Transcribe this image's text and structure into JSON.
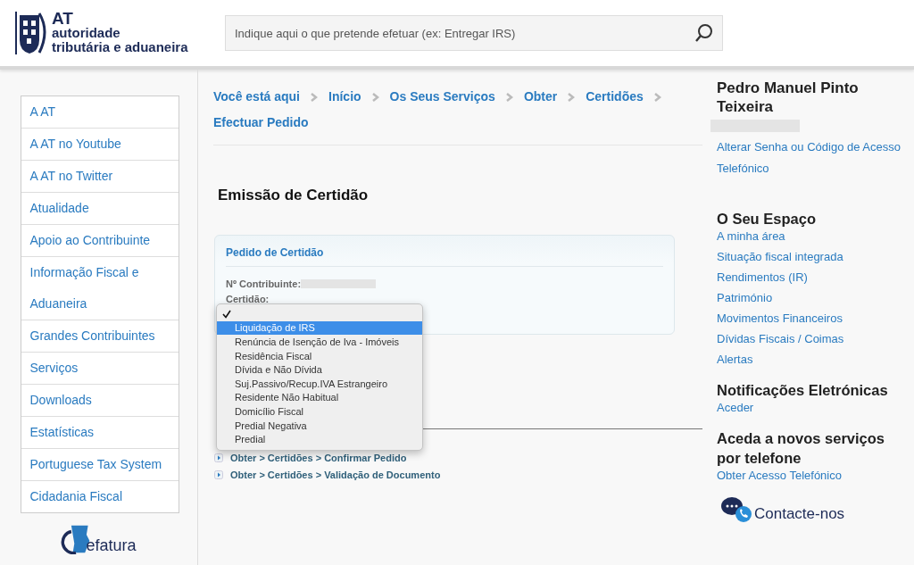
{
  "header": {
    "logo": {
      "abbr": "AT",
      "line_1": "autoridade",
      "line_2": "tributária e aduaneira"
    },
    "search": {
      "placeholder": "Indique aqui o que pretende efetuar (ex: Entregar IRS)"
    }
  },
  "sidebar": {
    "items": [
      {
        "label": "A AT"
      },
      {
        "label": "A AT no Youtube"
      },
      {
        "label": "A AT no Twitter"
      },
      {
        "label": "Atualidade"
      },
      {
        "label": "Apoio ao Contribuinte"
      },
      {
        "label": "Informação Fiscal e Aduaneira"
      },
      {
        "label": "Grandes Contribuintes"
      },
      {
        "label": "Serviços"
      },
      {
        "label": "Downloads"
      },
      {
        "label": "Estatísticas"
      },
      {
        "label": "Portuguese Tax System"
      },
      {
        "label": "Cidadania Fiscal"
      }
    ],
    "logo_text": "efatura"
  },
  "breadcrumb": [
    "Você está aqui",
    "Início",
    "Os Seus Serviços",
    "Obter",
    "Certidões",
    "Efectuar Pedido"
  ],
  "page_title": "Emissão de Certidão",
  "form": {
    "title": "Pedido de Certidão",
    "fields": [
      {
        "label": "Nº Contribuinte:",
        "redacted": true
      },
      {
        "label": "Certidão:",
        "redacted": false
      }
    ],
    "dropdown": {
      "options": [
        {
          "checked": true,
          "selected": false
        },
        {
          "label": "Liquidação de IRS",
          "checked": false,
          "selected": true
        },
        {
          "label": "Renúncia de Isenção de Iva - Imóveis",
          "checked": false,
          "selected": false
        },
        {
          "label": "Residência Fiscal",
          "checked": false,
          "selected": false
        },
        {
          "label": "Dívida e Não Dívida",
          "checked": false,
          "selected": false
        },
        {
          "label": "Suj.Passivo/Recup.IVA Estrangeiro",
          "checked": false,
          "selected": false
        },
        {
          "label": "Residente Não Habitual",
          "checked": false,
          "selected": false
        },
        {
          "label": "Domicílio Fiscal",
          "checked": false,
          "selected": false
        },
        {
          "label": "Predial Negativa",
          "checked": false,
          "selected": false
        },
        {
          "label": "Predial",
          "checked": false,
          "selected": false
        }
      ]
    }
  },
  "links": [
    "Obter > Certidões > Confirmar Pedido",
    "Obter > Certidões > Validação de Documento"
  ],
  "user": {
    "name": "Pedro Manuel Pinto Teixeira",
    "links": [
      "Alterar Senha ou Código de Acesso",
      "Telefónico"
    ]
  },
  "sections": [
    {
      "title": "O Seu Espaço",
      "links": [
        "A minha área",
        "Situação fiscal integrada",
        "Rendimentos (IR)",
        "Património",
        "Movimentos Financeiros",
        "Dívidas Fiscais / Coimas",
        "Alertas"
      ]
    },
    {
      "title": "Notificações Eletrónicas",
      "links": [
        "Aceder"
      ]
    },
    {
      "title": "Aceda a novos serviços por telefone",
      "links": [
        "Obter Acesso Telefónico"
      ]
    }
  ],
  "contact": "Contacte-nos"
}
